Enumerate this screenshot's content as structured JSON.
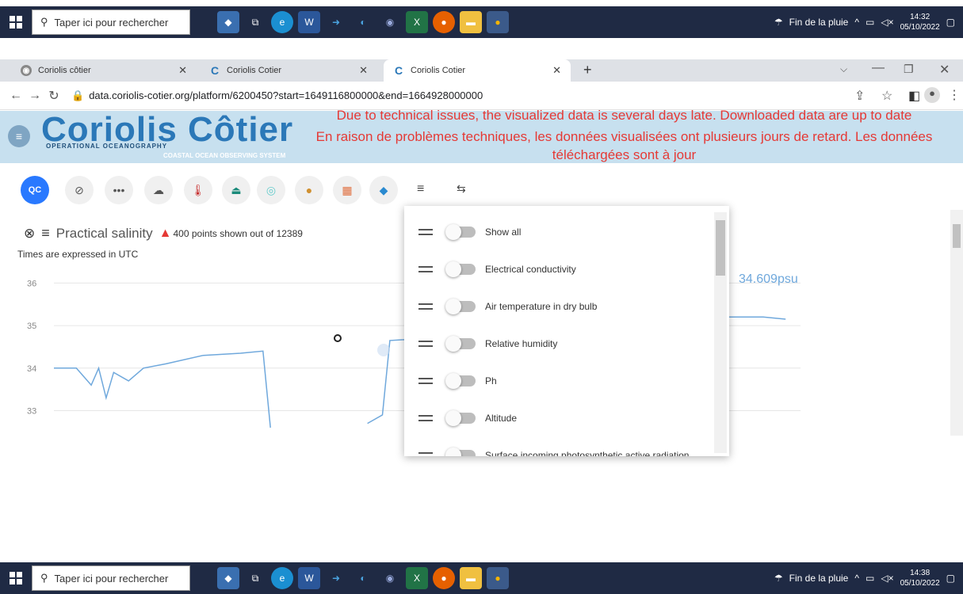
{
  "taskbar": {
    "search_placeholder": "Taper ici pour rechercher",
    "weather": "Fin de la pluie",
    "top_time": "14:32",
    "top_date": "05/10/2022",
    "bottom_time": "14:38",
    "bottom_date": "05/10/2022"
  },
  "browser": {
    "tabs": [
      {
        "title": "Coriolis côtier"
      },
      {
        "title": "Coriolis Cotier"
      },
      {
        "title": "Coriolis Cotier"
      }
    ],
    "new_tab": "+",
    "url": "data.coriolis-cotier.org/platform/6200450?start=1649116800000&end=1664928000000"
  },
  "banner": {
    "logo": "Coriolis Côtier",
    "logo_sub1": "OPERATIONAL OCEANOGRAPHY",
    "logo_sub2": "COASTAL OCEAN OBSERVING SYSTEM",
    "notice_en": "Due to technical issues, the visualized data is several days late. Downloaded data are up to date",
    "notice_fr": "En raison de problèmes techniques, les données visualisées ont plusieurs jours de retard. Les données téléchargées sont à jour"
  },
  "toolbar": {
    "qc_label": "QC"
  },
  "chart": {
    "title": "Practical salinity",
    "points_info": "400 points shown out of 12389",
    "time_note": "Times are expressed in UTC",
    "current_value": "34.609psu"
  },
  "chart_data": {
    "type": "line",
    "title": "Practical salinity",
    "xlabel": "",
    "ylabel": "",
    "ylim": [
      32.5,
      36.2
    ],
    "yticks": [
      33,
      34,
      35,
      36
    ],
    "x": [
      0,
      0.03,
      0.05,
      0.06,
      0.07,
      0.08,
      0.1,
      0.12,
      0.15,
      0.2,
      0.25,
      0.28,
      0.29,
      0.3,
      0.4,
      0.42,
      0.44,
      0.45,
      0.5,
      0.52,
      0.6,
      0.75,
      0.85,
      0.88,
      0.9,
      0.92,
      0.95,
      0.98
    ],
    "values": [
      34.0,
      34.0,
      33.6,
      34.0,
      33.3,
      33.9,
      33.7,
      34.0,
      34.1,
      34.3,
      34.35,
      34.4,
      32.6,
      null,
      null,
      32.7,
      32.9,
      34.65,
      34.7,
      34.75,
      null,
      null,
      34.9,
      34.9,
      35.2,
      35.2,
      35.2,
      35.15
    ],
    "series": [
      {
        "values": []
      }
    ],
    "grid": true
  },
  "menu": {
    "items": [
      {
        "label": "Show all",
        "on": false
      },
      {
        "label": "Electrical conductivity",
        "on": false
      },
      {
        "label": "Air temperature in dry bulb",
        "on": false
      },
      {
        "label": "Relative humidity",
        "on": false
      },
      {
        "label": "Ph",
        "on": false
      },
      {
        "label": "Altitude",
        "on": false
      },
      {
        "label": "Surface incoming photosynthetic active radiation",
        "on": false
      }
    ]
  }
}
